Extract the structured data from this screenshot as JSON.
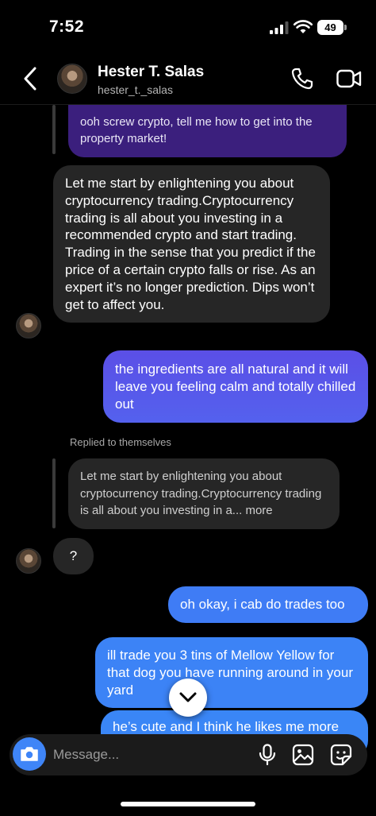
{
  "status_bar": {
    "time": "7:52",
    "battery": "49"
  },
  "header": {
    "name": "Hester T. Salas",
    "handle": "hester_t._salas"
  },
  "messages": {
    "quoted_outgoing": "ooh screw crypto, tell me how to get into the property market!",
    "incoming_1": "Let me start by enlightening you about cryptocurrency trading.Cryptocurrency trading is all about you investing in a recommended crypto and start trading. Trading in the sense that you predict if the price of a certain crypto falls or rise. As an expert it’s no longer prediction. Dips won’t get to affect you.",
    "outgoing_1": "the ingredients are all natural and it will leave you feeling calm and totally chilled out",
    "replied_label": "Replied to themselves",
    "reply_quote": "Let me start by enlightening you about cryptocurrency trading.Cryptocurrency trading is all about you investing in a... more",
    "incoming_2": "?",
    "outgoing_2": "oh okay, i cab do trades too",
    "outgoing_3": "ill trade you 3 tins of Mellow Yellow for that dog you have running around in your yard",
    "outgoing_4": "he’s cute and I think he likes me more"
  },
  "composer": {
    "placeholder": "Message..."
  },
  "colors": {
    "outgoing_purple": "#5b4fe6",
    "outgoing_blue": "#3f7cf5",
    "incoming": "#262626",
    "quoted": "#3b1f7d"
  }
}
